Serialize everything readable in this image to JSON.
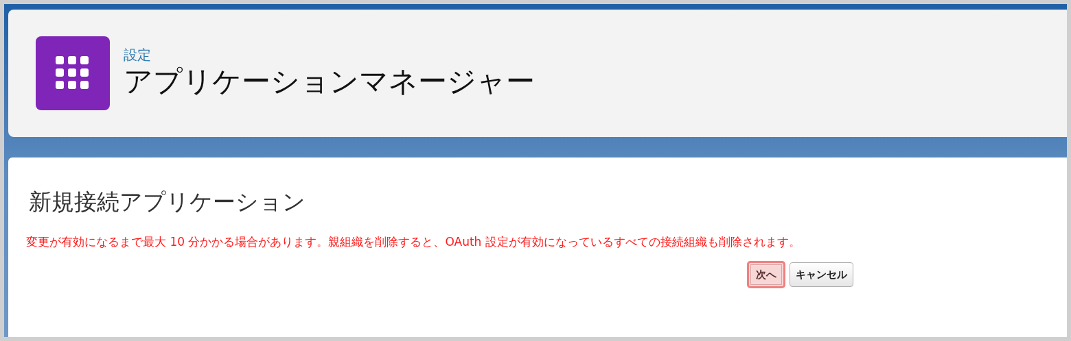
{
  "header": {
    "breadcrumb": "設定",
    "title": "アプリケーションマネージャー"
  },
  "panel": {
    "title": "新規接続アプリケーション",
    "warning": "変更が有効になるまで最大 10 分かかる場合があります。親組織を削除すると、OAuth 設定が有効になっているすべての接続組織も削除されます。",
    "buttons": [
      {
        "label": "次へ",
        "highlighted": true
      },
      {
        "label": "キャンセル",
        "highlighted": false
      }
    ]
  }
}
